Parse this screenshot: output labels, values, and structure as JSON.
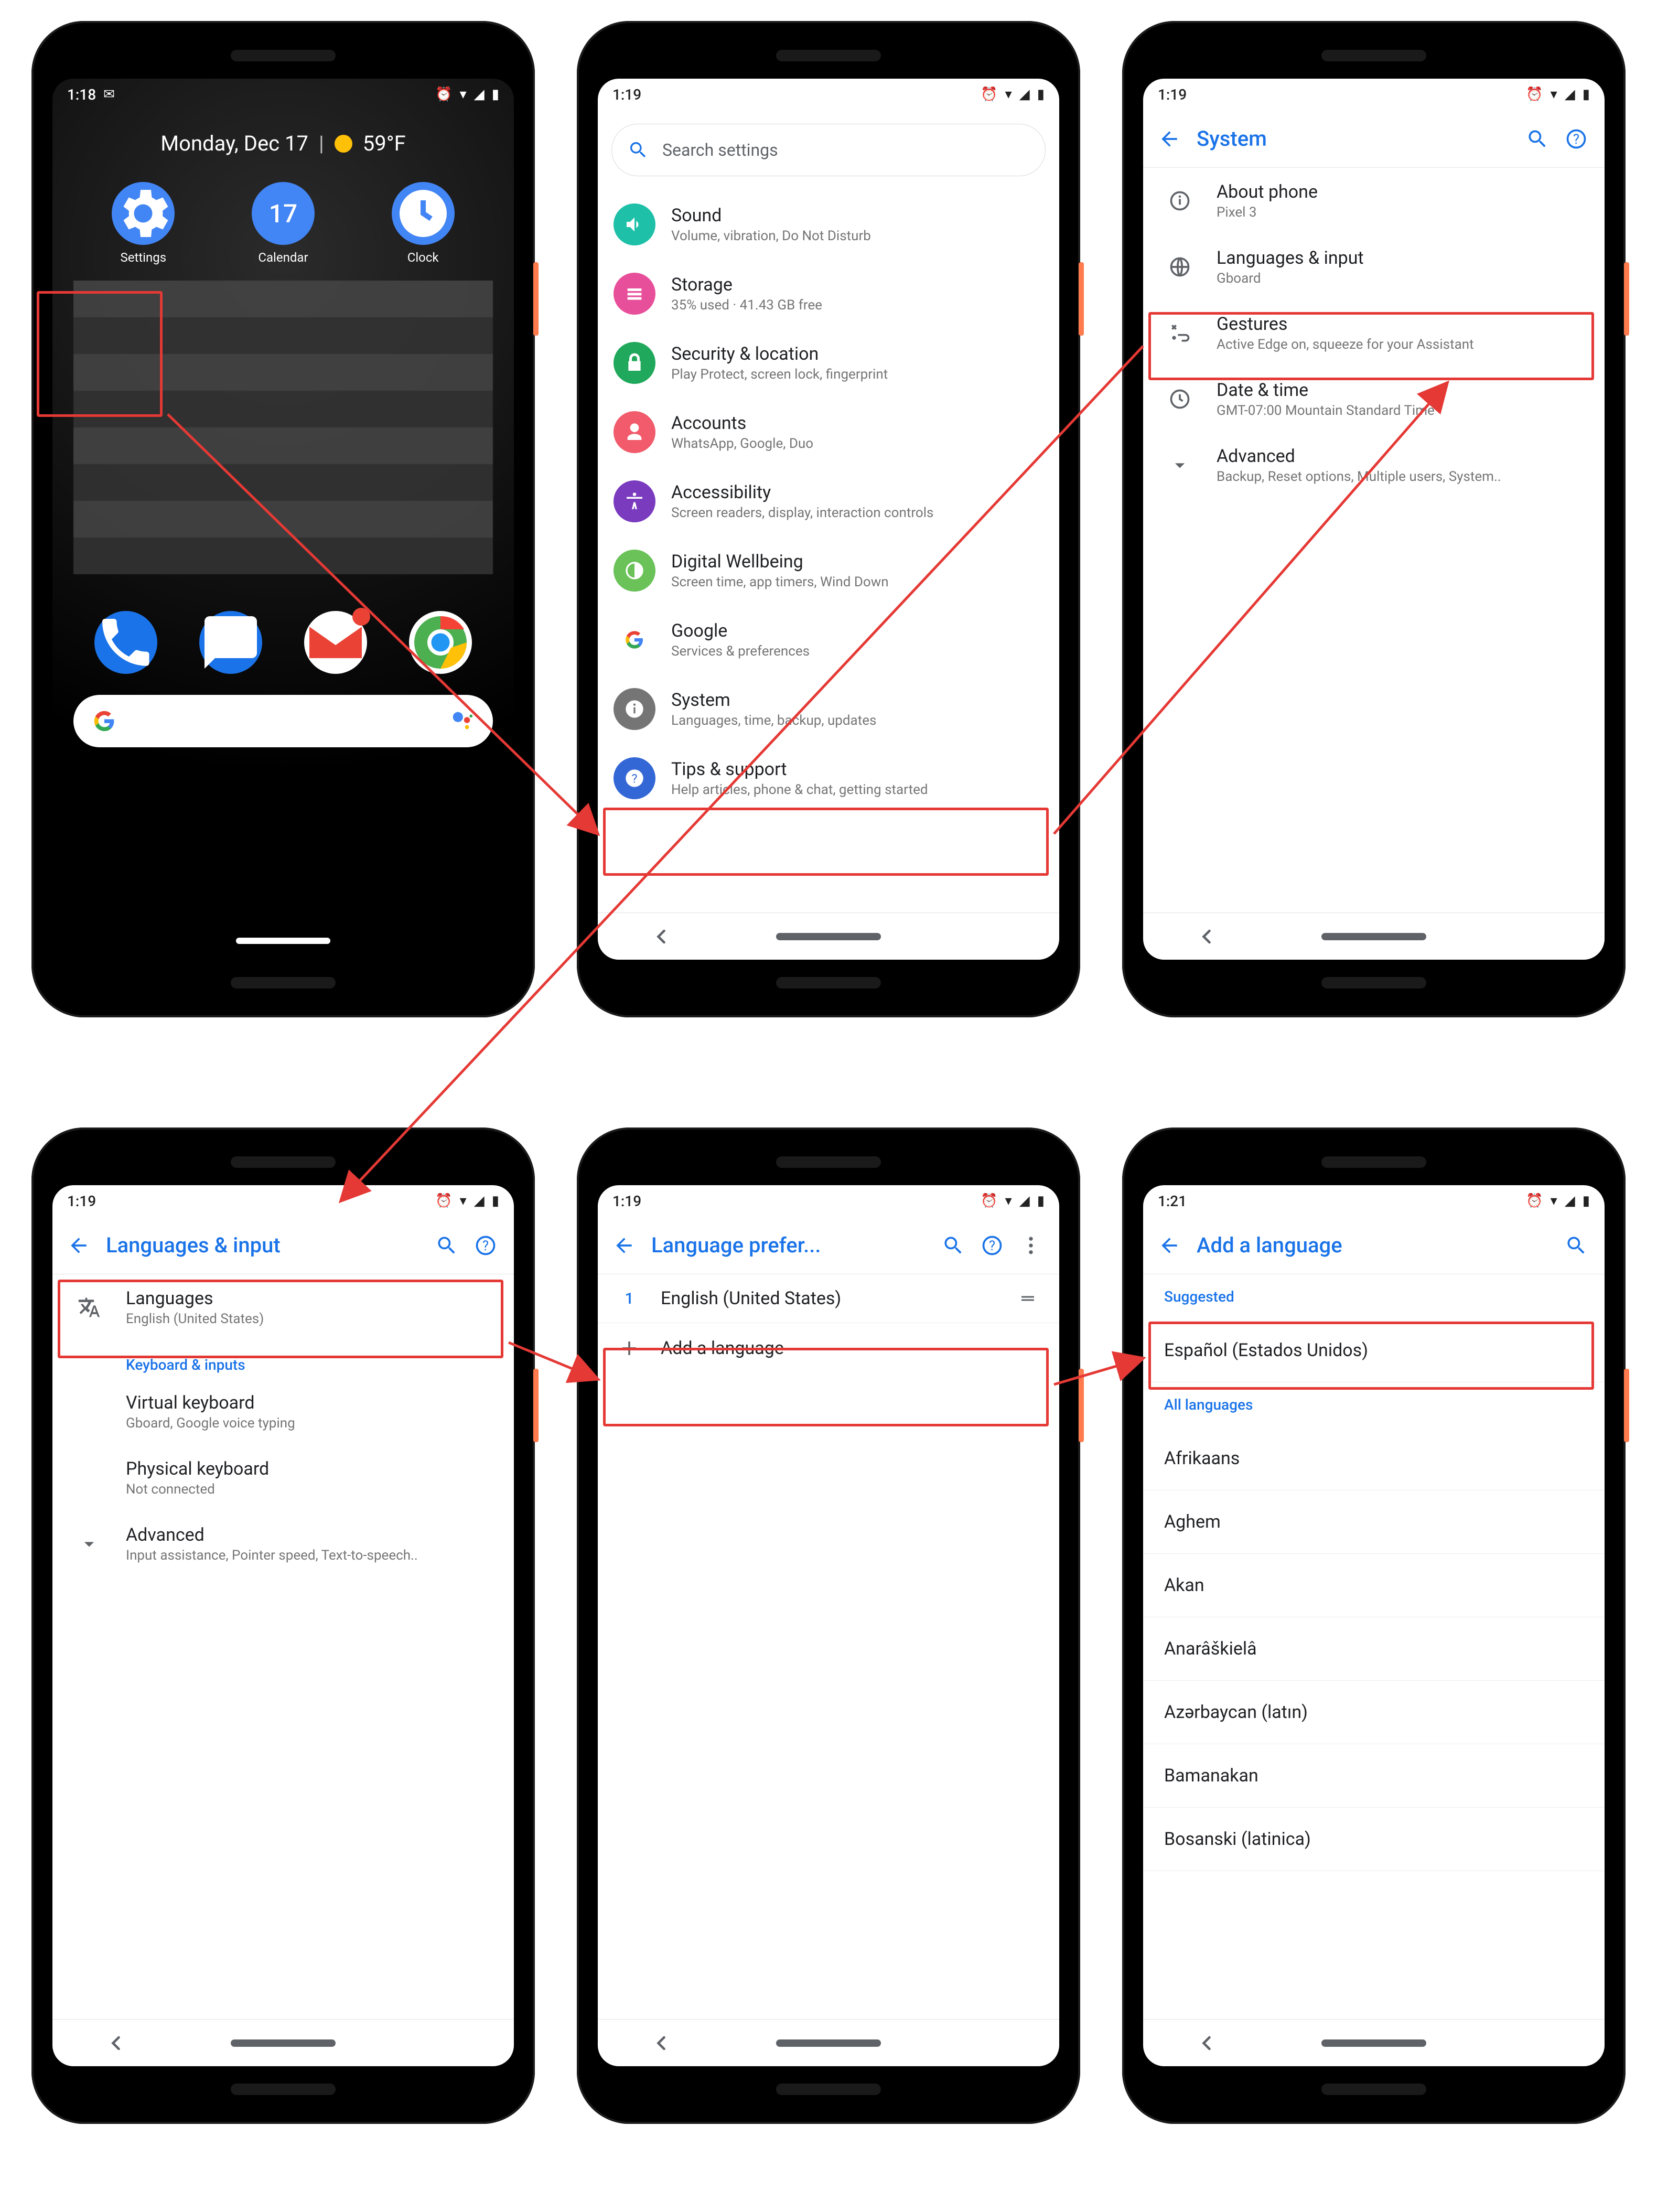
{
  "screen1": {
    "statusbar": {
      "time": "1:18"
    },
    "date_line": "Monday, Dec 17",
    "temperature": "59°F",
    "apps": [
      {
        "name": "Settings"
      },
      {
        "name": "Calendar",
        "badge": "17"
      },
      {
        "name": "Clock"
      }
    ],
    "dock": [
      "Phone",
      "Messages",
      "Gmail",
      "Chrome"
    ]
  },
  "screen2": {
    "statusbar": {
      "time": "1:19"
    },
    "search_placeholder": "Search settings",
    "rows": [
      {
        "icon": "volume",
        "color": "c-teal",
        "title": "Sound",
        "sub": "Volume, vibration, Do Not Disturb"
      },
      {
        "icon": "storage",
        "color": "c-pink",
        "title": "Storage",
        "sub": "35% used · 41.43 GB free"
      },
      {
        "icon": "lock",
        "color": "c-green",
        "title": "Security & location",
        "sub": "Play Protect, screen lock, fingerprint"
      },
      {
        "icon": "account",
        "color": "c-red",
        "title": "Accounts",
        "sub": "WhatsApp, Google, Duo"
      },
      {
        "icon": "a11y",
        "color": "c-purple",
        "title": "Accessibility",
        "sub": "Screen readers, display, interaction controls"
      },
      {
        "icon": "wellbeing",
        "color": "c-lime",
        "title": "Digital Wellbeing",
        "sub": "Screen time, app timers, Wind Down"
      },
      {
        "icon": "google",
        "color": "c-white",
        "title": "Google",
        "sub": "Services & preferences"
      },
      {
        "icon": "info",
        "color": "c-grey",
        "title": "System",
        "sub": "Languages, time, backup, updates"
      },
      {
        "icon": "help",
        "color": "c-navy",
        "title": "Tips & support",
        "sub": "Help articles, phone & chat, getting started"
      }
    ]
  },
  "screen3": {
    "statusbar": {
      "time": "1:19"
    },
    "title": "System",
    "rows": [
      {
        "icon": "phone-info",
        "title": "About phone",
        "sub": "Pixel 3"
      },
      {
        "icon": "globe",
        "title": "Languages & input",
        "sub": "Gboard"
      },
      {
        "icon": "gesture",
        "title": "Gestures",
        "sub": "Active Edge on, squeeze for your Assistant"
      },
      {
        "icon": "clock",
        "title": "Date & time",
        "sub": "GMT-07:00 Mountain Standard Time"
      },
      {
        "icon": "chev",
        "title": "Advanced",
        "sub": "Backup, Reset options, Multiple users, System.."
      }
    ]
  },
  "screen4": {
    "statusbar": {
      "time": "1:19"
    },
    "title": "Languages & input",
    "rows": [
      {
        "icon": "translate",
        "title": "Languages",
        "sub": "English (United States)"
      }
    ],
    "section_keyboard": "Keyboard & inputs",
    "kb_rows": [
      {
        "title": "Virtual keyboard",
        "sub": "Gboard, Google voice typing"
      },
      {
        "title": "Physical keyboard",
        "sub": "Not connected"
      }
    ],
    "adv": {
      "title": "Advanced",
      "sub": "Input assistance, Pointer speed, Text-to-speech.."
    }
  },
  "screen5": {
    "statusbar": {
      "time": "1:19"
    },
    "title": "Language prefer...",
    "lang_num": "1",
    "lang_current": "English (United States)",
    "add_label": "Add a language"
  },
  "screen6": {
    "statusbar": {
      "time": "1:21"
    },
    "title": "Add a language",
    "suggested_header": "Suggested",
    "suggested": [
      "Español (Estados Unidos)"
    ],
    "all_header": "All languages",
    "all": [
      "Afrikaans",
      "Aghem",
      "Akan",
      "Anarâškielâ",
      "Azərbaycan (latın)",
      "Bamanakan",
      "Bosanski (latinica)"
    ]
  }
}
